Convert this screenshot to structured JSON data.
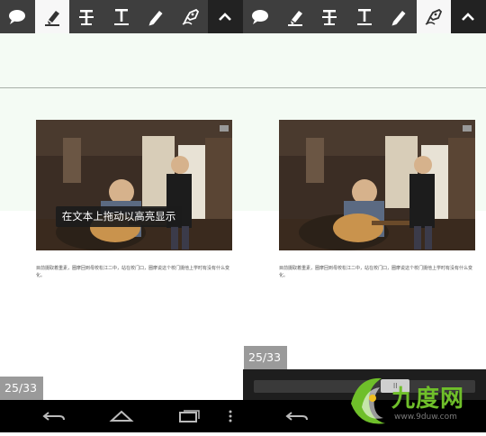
{
  "left_panel": {
    "toolbar": {
      "tools": [
        "comment-icon",
        "highlighter-icon",
        "strikethrough-icon",
        "underline-icon",
        "pencil-icon",
        "pen-nib-icon",
        "chevron-up-icon"
      ],
      "active": "highlighter-icon"
    },
    "tooltip": "在文本上拖动以高亮显示",
    "paragraph": "目前摄取着重素，圈摩回到母校松江二中，站在校门口，圈摩说这个校门摄他上学时有没有什么变化。",
    "page_indicator": "25/33"
  },
  "right_panel": {
    "toolbar": {
      "tools": [
        "comment-icon",
        "highlighter-icon",
        "strikethrough-icon",
        "underline-icon",
        "pencil-icon",
        "pen-nib-icon",
        "chevron-up-icon"
      ],
      "active": "pen-nib-icon"
    },
    "paragraph": "目前摄取着重素，圈摩回到母校松江二中，站在校门口，圈摩说这个校门摄他上学时有没有什么变化。",
    "page_indicator": "25/33",
    "scrubber": {
      "position": 0.66,
      "thumb_glyph": "II"
    }
  },
  "watermark": {
    "text": "九度网",
    "url": "www.9duw.com"
  },
  "colors": {
    "toolbar": "#3e3e3e",
    "active_tool": "#f7f7f7",
    "navbar": "#000000",
    "page_badge": "#9a9a9a"
  }
}
